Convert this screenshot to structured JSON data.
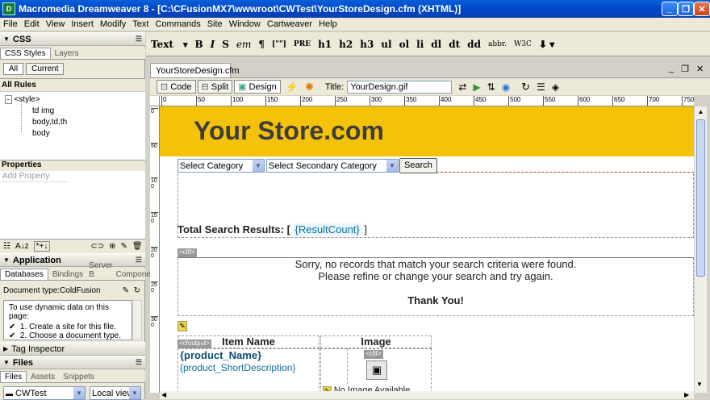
{
  "window": {
    "title": "Macromedia Dreamweaver 8 - [C:\\CFusionMX7\\wwwroot\\CWTest\\YourStoreDesign.cfm (XHTML)]"
  },
  "menu": [
    "File",
    "Edit",
    "View",
    "Insert",
    "Modify",
    "Text",
    "Commands",
    "Site",
    "Window",
    "Cartweaver",
    "Help"
  ],
  "insert_bar": {
    "category": "Text",
    "items": [
      "B",
      "I",
      "S",
      "em",
      "¶",
      "[\"\"]",
      "PRE",
      "h1",
      "h2",
      "h3",
      "ul",
      "ol",
      "li",
      "dl",
      "dt",
      "dd",
      "abbr.",
      "W3C"
    ]
  },
  "css_panel": {
    "title": "CSS",
    "tabs": [
      "CSS Styles",
      "Layers"
    ],
    "buttons": [
      "All",
      "Current"
    ],
    "section": "All Rules",
    "rules": [
      "<style>",
      "td img",
      "body,td,th",
      "body"
    ]
  },
  "properties": {
    "title": "Properties",
    "add": "Add Property"
  },
  "application": {
    "title": "Application",
    "tabs": [
      "Databases",
      "Bindings",
      "Server B",
      "Compone"
    ],
    "doc_type": "Document type:ColdFusion",
    "intro": "To use dynamic data on this page:",
    "steps": [
      "Create a site for this file.",
      "Choose a document type."
    ]
  },
  "tag_inspector": {
    "title": "Tag Inspector"
  },
  "files": {
    "title": "Files",
    "tabs": [
      "Files",
      "Assets",
      "Snippets"
    ],
    "site": "CWTest",
    "view": "Local view"
  },
  "document": {
    "tab": "YourStoreDesign.cfm",
    "code": "Code",
    "split": "Split",
    "design": "Design",
    "title_label": "Title:",
    "title_value": "YourDesign.gif"
  },
  "ruler": {
    "h": [
      "0",
      "50",
      "100",
      "150",
      "200",
      "250",
      "300",
      "350",
      "400",
      "450",
      "500",
      "550",
      "600",
      "650",
      "700",
      "750"
    ],
    "v": [
      "0",
      "50",
      "100",
      "150",
      "200",
      "250",
      "300"
    ]
  },
  "page": {
    "header": "Your Store.com",
    "header_bg": "#f5c20a",
    "category": "Select Category",
    "secondary": "Select Secondary Category",
    "search": "Search",
    "results_label": "Total Search Results: [",
    "result_count": "{ResultCount}",
    "results_end": "]",
    "cfif_tag": "<cfif>",
    "sorry1": "Sorry, no records that match your search criteria were found.",
    "sorry2": "Please refine or change your search and try again.",
    "thanks": "Thank You!",
    "col_item": "Item Name",
    "col_image": "Image",
    "cfoutput_tag": "<cfoutput>",
    "product_name": "{product_Name}",
    "product_desc": "{product_ShortDescription}",
    "cfif_tag2": "<cfif>",
    "no_image": "No Image Available"
  }
}
